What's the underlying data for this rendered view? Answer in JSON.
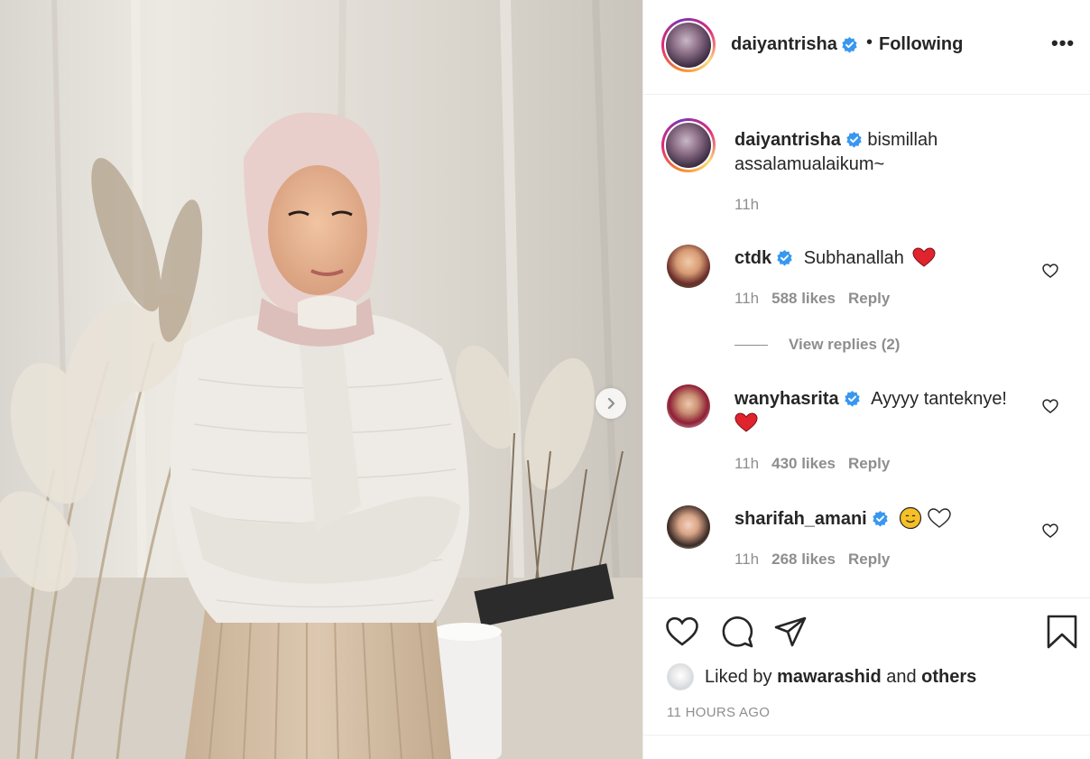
{
  "post": {
    "author": "daiyantrisha",
    "follow_dot": "•",
    "follow_status": "Following",
    "more_label": "•••",
    "caption_lines": "bismillah assalamualaikum~",
    "caption_time": "11h"
  },
  "comments": [
    {
      "username": "ctdk",
      "text": "Subhanallah",
      "emoji": "red-heart",
      "time": "11h",
      "likes": "588 likes",
      "reply": "Reply",
      "view_replies": "View replies (2)"
    },
    {
      "username": "wanyhasrita",
      "text": "Ayyyy tanteknye!",
      "emoji": "red-heart",
      "time": "11h",
      "likes": "430 likes",
      "reply": "Reply"
    },
    {
      "username": "sharifah_amani",
      "text": "",
      "emoji": "smiling-face + white-heart",
      "time": "11h",
      "likes": "268 likes",
      "reply": "Reply"
    }
  ],
  "actions": {
    "liked_prefix": "Liked by",
    "liked_user": "mawarashid",
    "liked_and": "and",
    "liked_others": "others",
    "timestamp": "11 HOURS AGO"
  },
  "icons": [
    "verified-badge-icon",
    "heart-icon",
    "comment-icon",
    "share-icon",
    "bookmark-icon",
    "chevron-right-icon"
  ],
  "colors": {
    "verified": "#3897f0",
    "heart_red": "#ed4956",
    "muted": "#8e8e8e",
    "text": "#262626"
  }
}
